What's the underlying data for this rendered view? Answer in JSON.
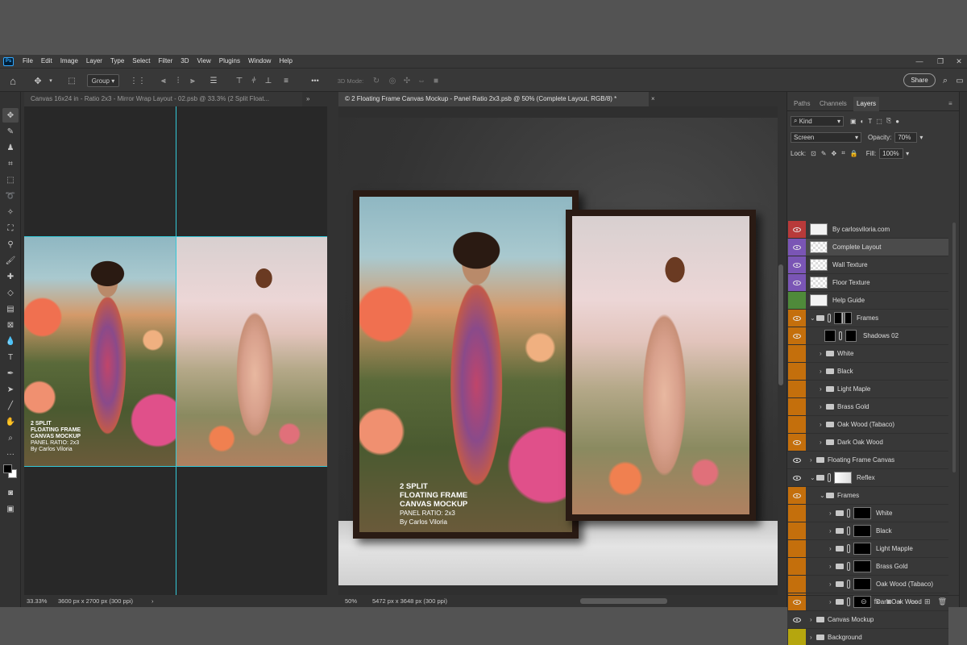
{
  "menu": [
    "File",
    "Edit",
    "Image",
    "Layer",
    "Type",
    "Select",
    "Filter",
    "3D",
    "View",
    "Plugins",
    "Window",
    "Help"
  ],
  "app_logo": "Ps",
  "window_controls": [
    "—",
    "❐",
    "✕"
  ],
  "options_bar": {
    "group_label": "Group",
    "mode_label": "3D Mode:",
    "more": "•••",
    "share": "Share"
  },
  "tabs": [
    {
      "title": "Canvas 16x24 in - Ratio 2x3 - Mirror Wrap Layout - 02.psb @ 33.3% (2 Split  Float...",
      "close": "»"
    },
    {
      "title": "© 2 Floating Frame Canvas Mockup - Panel Ratio 2x3.psb @ 50% (Complete Layout, RGB/8) *",
      "close": "×"
    }
  ],
  "left_doc": {
    "overlay": [
      "2 SPLIT",
      "FLOATING FRAME",
      "CANVAS MOCKUP",
      "PANEL RATIO: 2x3",
      "By Carlos Viloria"
    ],
    "zoom": "33.33%",
    "size": "3600 px x 2700 px (300 ppi)"
  },
  "main_doc": {
    "overlay": [
      "2 SPLIT",
      "FLOATING FRAME",
      "CANVAS MOCKUP",
      "PANEL RATIO: 2x3",
      "By Carlos Viloria"
    ],
    "zoom": "50%",
    "size": "5472 px x 3648 px (300 ppi)"
  },
  "layers_panel": {
    "tabs": [
      "Paths",
      "Channels",
      "Layers"
    ],
    "active_tab": "Layers",
    "kind": "Kind",
    "blend_mode": "Screen",
    "opacity_label": "Opacity:",
    "opacity": "70%",
    "lock_label": "Lock:",
    "fill_label": "Fill:",
    "fill": "100%",
    "layers": [
      {
        "name": "By carlosviloria.com",
        "color": "#b83a3a",
        "visible": true,
        "indent": 0,
        "type": "layer"
      },
      {
        "name": "Complete Layout",
        "color": "#7a55b5",
        "visible": true,
        "indent": 0,
        "type": "smart",
        "selected": true
      },
      {
        "name": "Wall Texture",
        "color": "#7a55b5",
        "visible": true,
        "indent": 0,
        "type": "smart"
      },
      {
        "name": "Floor Texture",
        "color": "#7a55b5",
        "visible": true,
        "indent": 0,
        "type": "smart"
      },
      {
        "name": "Help Guide",
        "color": "#4f8a3a",
        "visible": false,
        "indent": 0,
        "type": "layer"
      },
      {
        "name": "Frames",
        "color": "#c46f0c",
        "visible": true,
        "indent": 0,
        "type": "group-open-mask"
      },
      {
        "name": "Shadows 02",
        "color": "#c46f0c",
        "visible": true,
        "indent": 1,
        "type": "mask"
      },
      {
        "name": "White",
        "color": "#c46f0c",
        "visible": false,
        "indent": 1,
        "type": "folder"
      },
      {
        "name": "Black",
        "color": "#c46f0c",
        "visible": false,
        "indent": 1,
        "type": "folder"
      },
      {
        "name": "Light Maple",
        "color": "#c46f0c",
        "visible": false,
        "indent": 1,
        "type": "folder"
      },
      {
        "name": "Brass Gold",
        "color": "#c46f0c",
        "visible": false,
        "indent": 1,
        "type": "folder"
      },
      {
        "name": "Oak Wood (Tabaco)",
        "color": "#c46f0c",
        "visible": false,
        "indent": 1,
        "type": "folder"
      },
      {
        "name": "Dark Oak Wood",
        "color": "#c46f0c",
        "visible": true,
        "indent": 1,
        "type": "folder"
      },
      {
        "name": "Floating Frame Canvas",
        "color": "#383838",
        "visible": true,
        "indent": 0,
        "type": "folder"
      },
      {
        "name": "Reflex",
        "color": "#383838",
        "visible": true,
        "indent": 0,
        "type": "group-open-white"
      },
      {
        "name": "Frames",
        "color": "#c46f0c",
        "visible": true,
        "indent": 1,
        "type": "group-open"
      },
      {
        "name": "White",
        "color": "#c46f0c",
        "visible": false,
        "indent": 2,
        "type": "folder-mask"
      },
      {
        "name": "Black",
        "color": "#c46f0c",
        "visible": false,
        "indent": 2,
        "type": "folder-mask"
      },
      {
        "name": "Light Mapple",
        "color": "#c46f0c",
        "visible": false,
        "indent": 2,
        "type": "folder-mask"
      },
      {
        "name": "Brass Gold",
        "color": "#c46f0c",
        "visible": false,
        "indent": 2,
        "type": "folder-mask"
      },
      {
        "name": "Oak Wood (Tabaco)",
        "color": "#c46f0c",
        "visible": false,
        "indent": 2,
        "type": "folder-mask"
      },
      {
        "name": "Dark Oak Wood",
        "color": "#c46f0c",
        "visible": true,
        "indent": 2,
        "type": "folder-mask"
      },
      {
        "name": "Canvas Mockup",
        "color": "#383838",
        "visible": true,
        "indent": 0,
        "type": "folder"
      },
      {
        "name": "Background",
        "color": "#b5a60e",
        "visible": false,
        "indent": 0,
        "type": "folder"
      }
    ],
    "bottom_icons": [
      "link-icon",
      "fx-icon",
      "mask-icon",
      "adjustment-icon",
      "folder-icon",
      "new-layer-icon",
      "trash-icon"
    ],
    "bottom_glyphs": [
      "⊝",
      "fx",
      "◙",
      "◐",
      "▭",
      "⊞",
      "🗑"
    ]
  }
}
